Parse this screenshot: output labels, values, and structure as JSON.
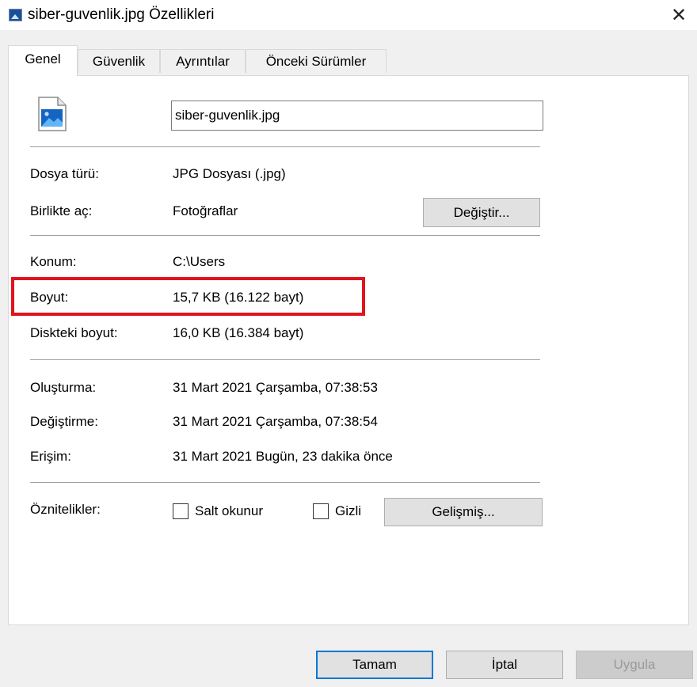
{
  "window": {
    "title": "siber-guvenlik.jpg Özellikleri",
    "close_glyph": "✕"
  },
  "tabs": [
    {
      "label": "Genel",
      "active": true
    },
    {
      "label": "Güvenlik",
      "active": false
    },
    {
      "label": "Ayrıntılar",
      "active": false
    },
    {
      "label": "Önceki Sürümler",
      "active": false
    }
  ],
  "general": {
    "file_icon": "image-file-icon",
    "filename": "siber-guvenlik.jpg",
    "file_type": {
      "label": "Dosya türü:",
      "value": "JPG Dosyası (.jpg)"
    },
    "opens_with": {
      "label": "Birlikte aç:",
      "value": "Fotoğraflar",
      "change_button": "Değiştir..."
    },
    "location": {
      "label": "Konum:",
      "value": "C:\\Users"
    },
    "size": {
      "label": "Boyut:",
      "value": "15,7 KB (16.122 bayt)"
    },
    "size_on_disk": {
      "label": "Diskteki boyut:",
      "value": "16,0 KB (16.384 bayt)"
    },
    "created": {
      "label": "Oluşturma:",
      "value": "31 Mart 2021 Çarşamba, 07:38:53"
    },
    "modified": {
      "label": "Değiştirme:",
      "value": "31 Mart 2021 Çarşamba, 07:38:54"
    },
    "accessed": {
      "label": "Erişim:",
      "value": "31 Mart 2021 Bugün, 23 dakika önce"
    },
    "attributes": {
      "label": "Öznitelikler:",
      "readonly_label": "Salt okunur",
      "readonly_checked": false,
      "hidden_label": "Gizli",
      "hidden_checked": false,
      "advanced_button": "Gelişmiş..."
    }
  },
  "footer": {
    "ok": "Tamam",
    "cancel": "İptal",
    "apply": "Uygula"
  },
  "colors": {
    "highlight": "#e0141e",
    "default_button_border": "#0078d7"
  }
}
